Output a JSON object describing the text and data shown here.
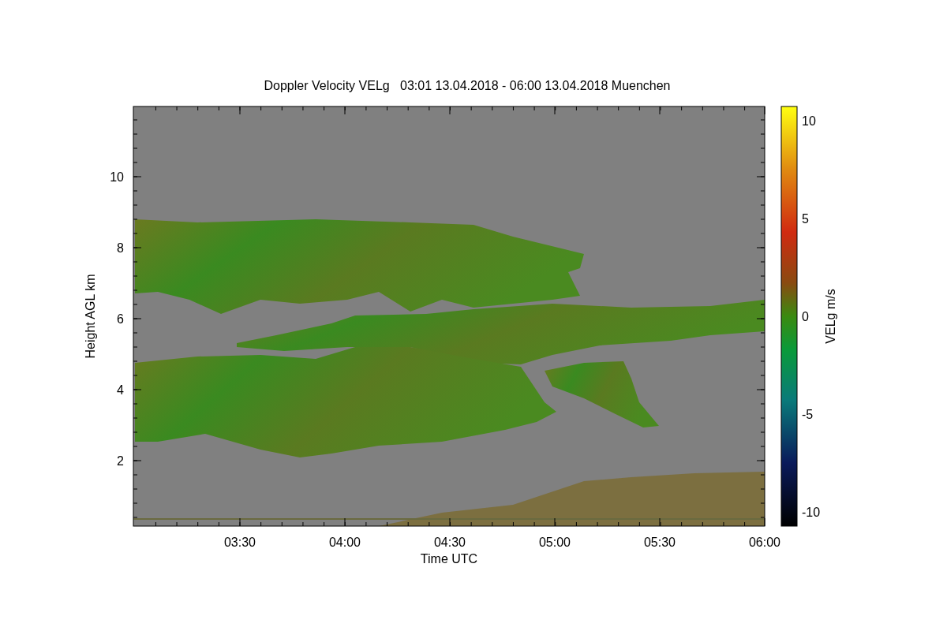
{
  "chart": {
    "title": "Doppler Velocity VELg   03:01 13.04.2018 - 06:00 13.04.2018 Muenchen",
    "xlabel": "Time UTC",
    "ylabel": "Height AGL km",
    "xticks": [
      "03:30",
      "04:00",
      "04:30",
      "05:00",
      "05:30",
      "06:00"
    ],
    "yticks": [
      "10",
      "8",
      "6",
      "4",
      "2"
    ]
  },
  "colorbar": {
    "label": "VELg m/s",
    "ticks": [
      "10",
      "5",
      "0",
      "-5",
      "-10"
    ]
  }
}
